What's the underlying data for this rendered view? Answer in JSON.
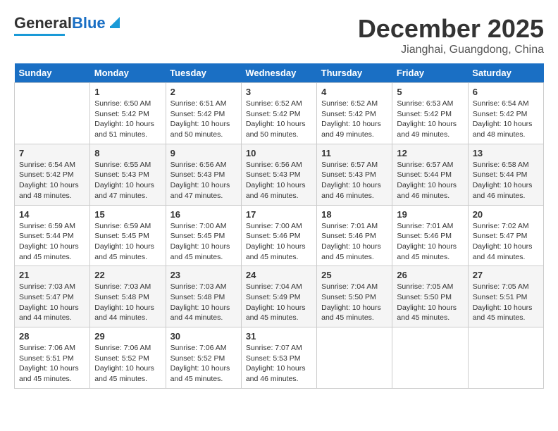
{
  "header": {
    "logo_general": "General",
    "logo_blue": "Blue",
    "month_year": "December 2025",
    "location": "Jianghai, Guangdong, China"
  },
  "calendar": {
    "days_of_week": [
      "Sunday",
      "Monday",
      "Tuesday",
      "Wednesday",
      "Thursday",
      "Friday",
      "Saturday"
    ],
    "weeks": [
      [
        {
          "day": "",
          "info": ""
        },
        {
          "day": "1",
          "info": "Sunrise: 6:50 AM\nSunset: 5:42 PM\nDaylight: 10 hours\nand 51 minutes."
        },
        {
          "day": "2",
          "info": "Sunrise: 6:51 AM\nSunset: 5:42 PM\nDaylight: 10 hours\nand 50 minutes."
        },
        {
          "day": "3",
          "info": "Sunrise: 6:52 AM\nSunset: 5:42 PM\nDaylight: 10 hours\nand 50 minutes."
        },
        {
          "day": "4",
          "info": "Sunrise: 6:52 AM\nSunset: 5:42 PM\nDaylight: 10 hours\nand 49 minutes."
        },
        {
          "day": "5",
          "info": "Sunrise: 6:53 AM\nSunset: 5:42 PM\nDaylight: 10 hours\nand 49 minutes."
        },
        {
          "day": "6",
          "info": "Sunrise: 6:54 AM\nSunset: 5:42 PM\nDaylight: 10 hours\nand 48 minutes."
        }
      ],
      [
        {
          "day": "7",
          "info": "Sunrise: 6:54 AM\nSunset: 5:42 PM\nDaylight: 10 hours\nand 48 minutes."
        },
        {
          "day": "8",
          "info": "Sunrise: 6:55 AM\nSunset: 5:43 PM\nDaylight: 10 hours\nand 47 minutes."
        },
        {
          "day": "9",
          "info": "Sunrise: 6:56 AM\nSunset: 5:43 PM\nDaylight: 10 hours\nand 47 minutes."
        },
        {
          "day": "10",
          "info": "Sunrise: 6:56 AM\nSunset: 5:43 PM\nDaylight: 10 hours\nand 46 minutes."
        },
        {
          "day": "11",
          "info": "Sunrise: 6:57 AM\nSunset: 5:43 PM\nDaylight: 10 hours\nand 46 minutes."
        },
        {
          "day": "12",
          "info": "Sunrise: 6:57 AM\nSunset: 5:44 PM\nDaylight: 10 hours\nand 46 minutes."
        },
        {
          "day": "13",
          "info": "Sunrise: 6:58 AM\nSunset: 5:44 PM\nDaylight: 10 hours\nand 46 minutes."
        }
      ],
      [
        {
          "day": "14",
          "info": "Sunrise: 6:59 AM\nSunset: 5:44 PM\nDaylight: 10 hours\nand 45 minutes."
        },
        {
          "day": "15",
          "info": "Sunrise: 6:59 AM\nSunset: 5:45 PM\nDaylight: 10 hours\nand 45 minutes."
        },
        {
          "day": "16",
          "info": "Sunrise: 7:00 AM\nSunset: 5:45 PM\nDaylight: 10 hours\nand 45 minutes."
        },
        {
          "day": "17",
          "info": "Sunrise: 7:00 AM\nSunset: 5:46 PM\nDaylight: 10 hours\nand 45 minutes."
        },
        {
          "day": "18",
          "info": "Sunrise: 7:01 AM\nSunset: 5:46 PM\nDaylight: 10 hours\nand 45 minutes."
        },
        {
          "day": "19",
          "info": "Sunrise: 7:01 AM\nSunset: 5:46 PM\nDaylight: 10 hours\nand 45 minutes."
        },
        {
          "day": "20",
          "info": "Sunrise: 7:02 AM\nSunset: 5:47 PM\nDaylight: 10 hours\nand 44 minutes."
        }
      ],
      [
        {
          "day": "21",
          "info": "Sunrise: 7:03 AM\nSunset: 5:47 PM\nDaylight: 10 hours\nand 44 minutes."
        },
        {
          "day": "22",
          "info": "Sunrise: 7:03 AM\nSunset: 5:48 PM\nDaylight: 10 hours\nand 44 minutes."
        },
        {
          "day": "23",
          "info": "Sunrise: 7:03 AM\nSunset: 5:48 PM\nDaylight: 10 hours\nand 44 minutes."
        },
        {
          "day": "24",
          "info": "Sunrise: 7:04 AM\nSunset: 5:49 PM\nDaylight: 10 hours\nand 45 minutes."
        },
        {
          "day": "25",
          "info": "Sunrise: 7:04 AM\nSunset: 5:50 PM\nDaylight: 10 hours\nand 45 minutes."
        },
        {
          "day": "26",
          "info": "Sunrise: 7:05 AM\nSunset: 5:50 PM\nDaylight: 10 hours\nand 45 minutes."
        },
        {
          "day": "27",
          "info": "Sunrise: 7:05 AM\nSunset: 5:51 PM\nDaylight: 10 hours\nand 45 minutes."
        }
      ],
      [
        {
          "day": "28",
          "info": "Sunrise: 7:06 AM\nSunset: 5:51 PM\nDaylight: 10 hours\nand 45 minutes."
        },
        {
          "day": "29",
          "info": "Sunrise: 7:06 AM\nSunset: 5:52 PM\nDaylight: 10 hours\nand 45 minutes."
        },
        {
          "day": "30",
          "info": "Sunrise: 7:06 AM\nSunset: 5:52 PM\nDaylight: 10 hours\nand 45 minutes."
        },
        {
          "day": "31",
          "info": "Sunrise: 7:07 AM\nSunset: 5:53 PM\nDaylight: 10 hours\nand 46 minutes."
        },
        {
          "day": "",
          "info": ""
        },
        {
          "day": "",
          "info": ""
        },
        {
          "day": "",
          "info": ""
        }
      ]
    ]
  }
}
